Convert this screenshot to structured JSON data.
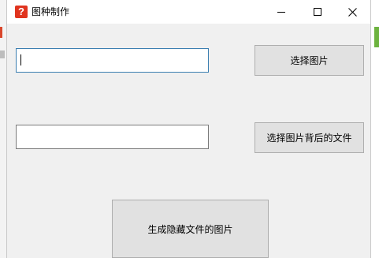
{
  "window": {
    "title": "图种制作",
    "app_icon": "?"
  },
  "titlebar_buttons": {
    "minimize_icon": "minimize-icon",
    "maximize_icon": "maximize-icon",
    "close_icon": "close-icon"
  },
  "inputs": {
    "image_path": {
      "value": "",
      "placeholder": ""
    },
    "file_path": {
      "value": "",
      "placeholder": ""
    }
  },
  "buttons": {
    "select_image": "选择图片",
    "select_hidden_file": "选择图片背后的文件",
    "generate": "生成隐藏文件的图片"
  },
  "colors": {
    "window_bg": "#f0f0f0",
    "button_bg": "#e1e1e1",
    "focus_border": "#3c7fb1",
    "icon_red": "#e0341f"
  }
}
